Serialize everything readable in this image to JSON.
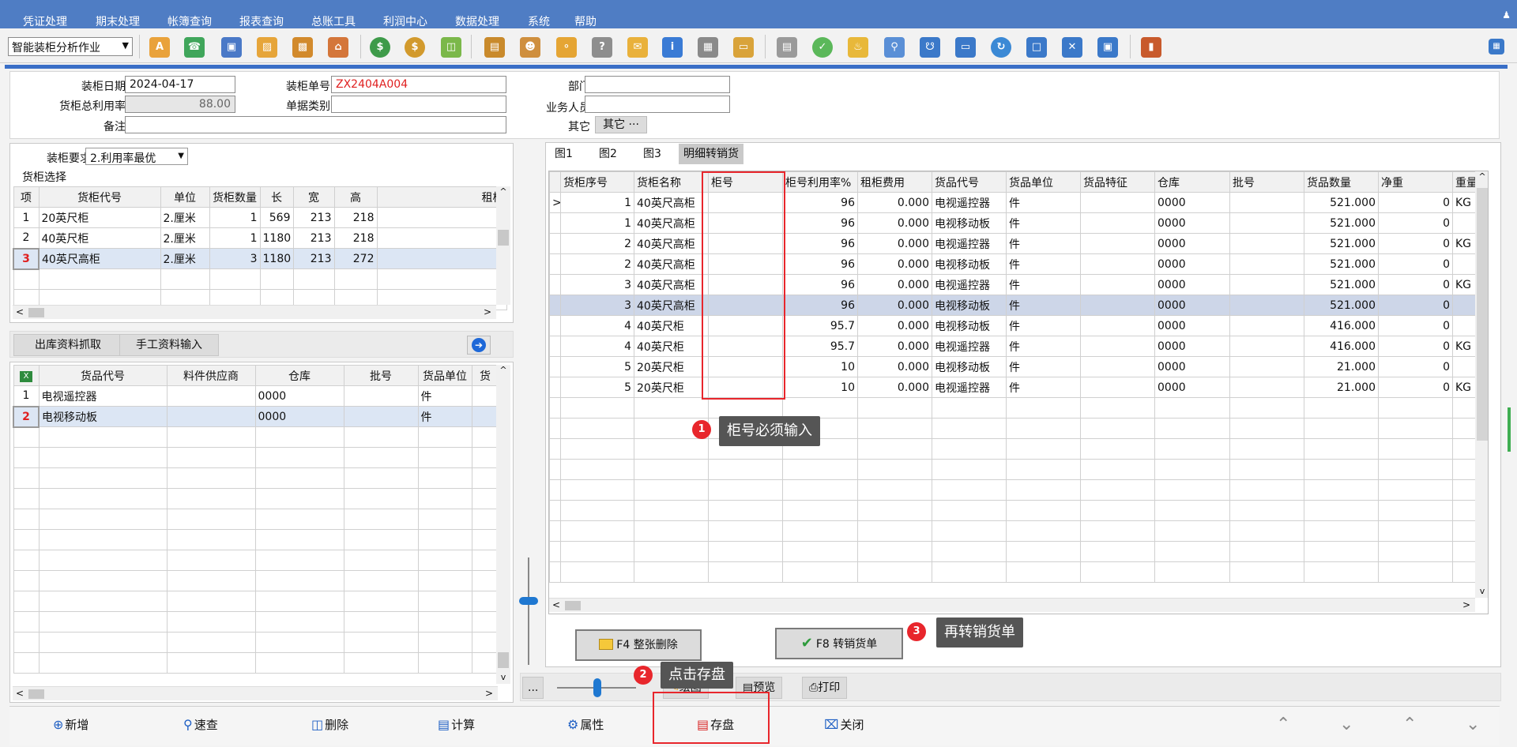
{
  "menu": [
    "凭证处理",
    "期末处理",
    "帐簿查询",
    "报表查询",
    "总账工具",
    "利润中心",
    "数据处理",
    "系统",
    "帮助"
  ],
  "toolbar": {
    "module_select": "智能装柜分析作业"
  },
  "header": {
    "date_label": "装柜日期",
    "date_value": "2024-04-17",
    "no_label": "装柜单号",
    "no_value": "ZX2404A004",
    "dept_label": "部门",
    "dept_value": "",
    "util_label": "货柜总利用率",
    "util_value": "88.00",
    "type_label": "单据类别",
    "type_value": "",
    "sales_label": "业务人员",
    "sales_value": "",
    "note_label": "备注",
    "note_value": "",
    "other_label": "其它",
    "other_btn": "其它 ···"
  },
  "container_select": {
    "req_label": "装柜要求",
    "req_value": "2.利用率最优",
    "section_label": "货柜选择",
    "columns": [
      "项",
      "货柜代号",
      "单位",
      "货柜数量",
      "长",
      "宽",
      "高",
      "租柜"
    ],
    "rows": [
      [
        "1",
        "20英尺柜",
        "2.厘米",
        "1",
        "569",
        "213",
        "218",
        ""
      ],
      [
        "2",
        "40英尺柜",
        "2.厘米",
        "1",
        "1180",
        "213",
        "218",
        ""
      ],
      [
        "3",
        "40英尺高柜",
        "2.厘米",
        "3",
        "1180",
        "213",
        "272",
        ""
      ]
    ]
  },
  "mid_buttons": {
    "fetch": "出库资料抓取",
    "manual": "手工资料输入"
  },
  "goods": {
    "columns": [
      "",
      "货品代号",
      "料件供应商",
      "仓库",
      "批号",
      "货品单位",
      "货"
    ],
    "rows": [
      [
        "1",
        "电视遥控器",
        "",
        "0000",
        "",
        "件",
        ""
      ],
      [
        "2",
        "电视移动板",
        "",
        "0000",
        "",
        "件",
        ""
      ]
    ]
  },
  "tabs": [
    "图1",
    "图2",
    "图3",
    "明细转销货"
  ],
  "detail": {
    "columns": [
      "货柜序号",
      "货柜名称",
      "柜号",
      "柜号利用率%",
      "租柜费用",
      "货品代号",
      "货品单位",
      "货品特征",
      "仓库",
      "批号",
      "货品数量",
      "净重",
      "重量单"
    ],
    "rows": [
      [
        "1",
        "40英尺高柜",
        "",
        "96",
        "0.000",
        "电视遥控器",
        "件",
        "",
        "0000",
        "",
        "521.000",
        "0",
        "KG"
      ],
      [
        "1",
        "40英尺高柜",
        "",
        "96",
        "0.000",
        "电视移动板",
        "件",
        "",
        "0000",
        "",
        "521.000",
        "0",
        ""
      ],
      [
        "2",
        "40英尺高柜",
        "",
        "96",
        "0.000",
        "电视遥控器",
        "件",
        "",
        "0000",
        "",
        "521.000",
        "0",
        "KG"
      ],
      [
        "2",
        "40英尺高柜",
        "",
        "96",
        "0.000",
        "电视移动板",
        "件",
        "",
        "0000",
        "",
        "521.000",
        "0",
        ""
      ],
      [
        "3",
        "40英尺高柜",
        "",
        "96",
        "0.000",
        "电视遥控器",
        "件",
        "",
        "0000",
        "",
        "521.000",
        "0",
        "KG"
      ],
      [
        "3",
        "40英尺高柜",
        "",
        "96",
        "0.000",
        "电视移动板",
        "件",
        "",
        "0000",
        "",
        "521.000",
        "0",
        ""
      ],
      [
        "4",
        "40英尺柜",
        "",
        "95.7",
        "0.000",
        "电视移动板",
        "件",
        "",
        "0000",
        "",
        "416.000",
        "0",
        ""
      ],
      [
        "4",
        "40英尺柜",
        "",
        "95.7",
        "0.000",
        "电视遥控器",
        "件",
        "",
        "0000",
        "",
        "416.000",
        "0",
        "KG"
      ],
      [
        "5",
        "20英尺柜",
        "",
        "10",
        "0.000",
        "电视移动板",
        "件",
        "",
        "0000",
        "",
        "21.000",
        "0",
        ""
      ],
      [
        "5",
        "20英尺柜",
        "",
        "10",
        "0.000",
        "电视遥控器",
        "件",
        "",
        "0000",
        "",
        "21.000",
        "0",
        "KG"
      ]
    ]
  },
  "callouts": [
    {
      "num": "1",
      "text": "柜号必须输入"
    },
    {
      "num": "2",
      "text": "点击存盘"
    },
    {
      "num": "3",
      "text": "再转销货单"
    }
  ],
  "action_buttons": {
    "delete_all": "F4 整张删除",
    "convert": "F8 转销货单"
  },
  "view_bar": {
    "more": "...",
    "graph": "绘图",
    "preview": "预览",
    "print": "打印"
  },
  "bottom": {
    "add": "新增",
    "query": "速查",
    "delete": "删除",
    "calc": "计算",
    "props": "属性",
    "save": "存盘",
    "close": "关闭"
  },
  "colors": {
    "menubar": "#4f7dc4",
    "accent_red": "#e8262c",
    "selected_row": "#dce6f4"
  }
}
